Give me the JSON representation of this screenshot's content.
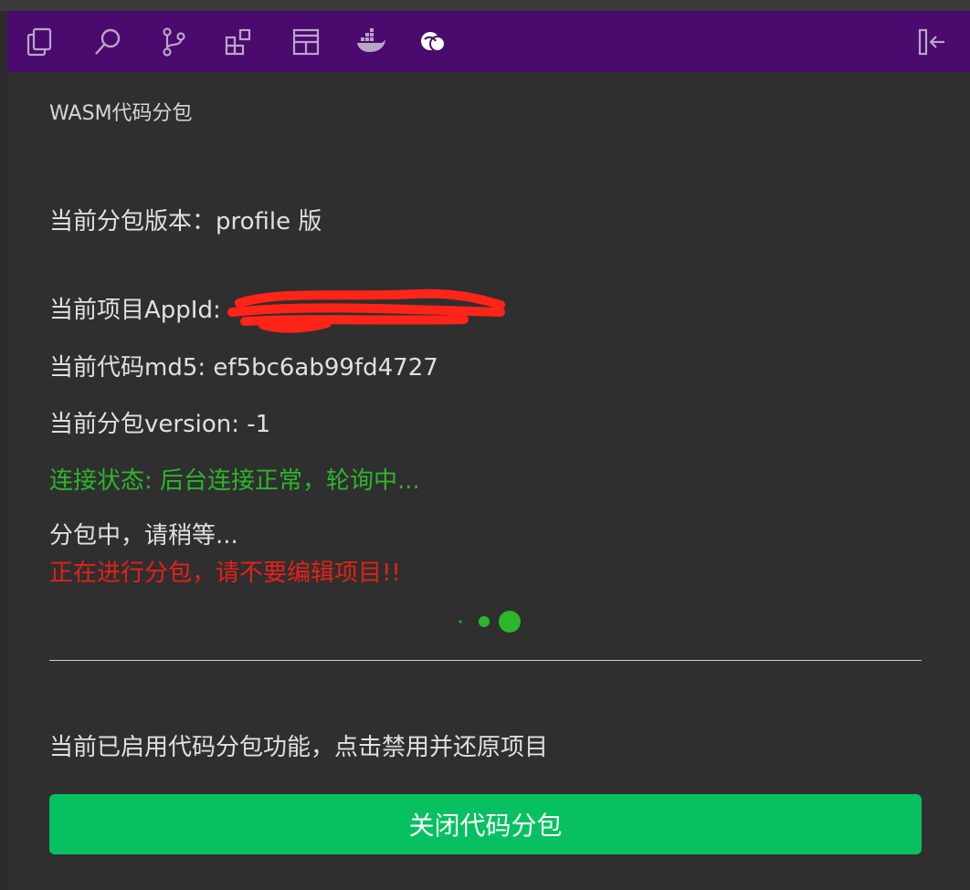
{
  "toolbar": {
    "icons": [
      "files-icon",
      "search-icon",
      "git-branch-icon",
      "extensions-icon",
      "layout-icon",
      "docker-icon",
      "wasm-plugin-icon"
    ],
    "collapse_icon": "collapse-sidebar-icon",
    "background": "#4a0a6e"
  },
  "panel": {
    "title": "WASM代码分包",
    "version_line": "当前分包版本：profile 版",
    "appid_line": "当前项目AppId:",
    "md5_line": "当前代码md5: ef5bc6ab99fd4727",
    "package_version_line": "当前分包version: -1",
    "connection_status": "连接状态: 后台连接正常，轮询中...",
    "progress_text": "分包中，请稍等...",
    "warning_text": "正在进行分包，请不要编辑项目!!",
    "enabled_hint": "当前已启用代码分包功能，点击禁用并还原项目",
    "close_button_label": "关闭代码分包"
  },
  "colors": {
    "status_green": "#2bb62b",
    "warning_red": "#e32118",
    "button_green": "#07c160"
  }
}
